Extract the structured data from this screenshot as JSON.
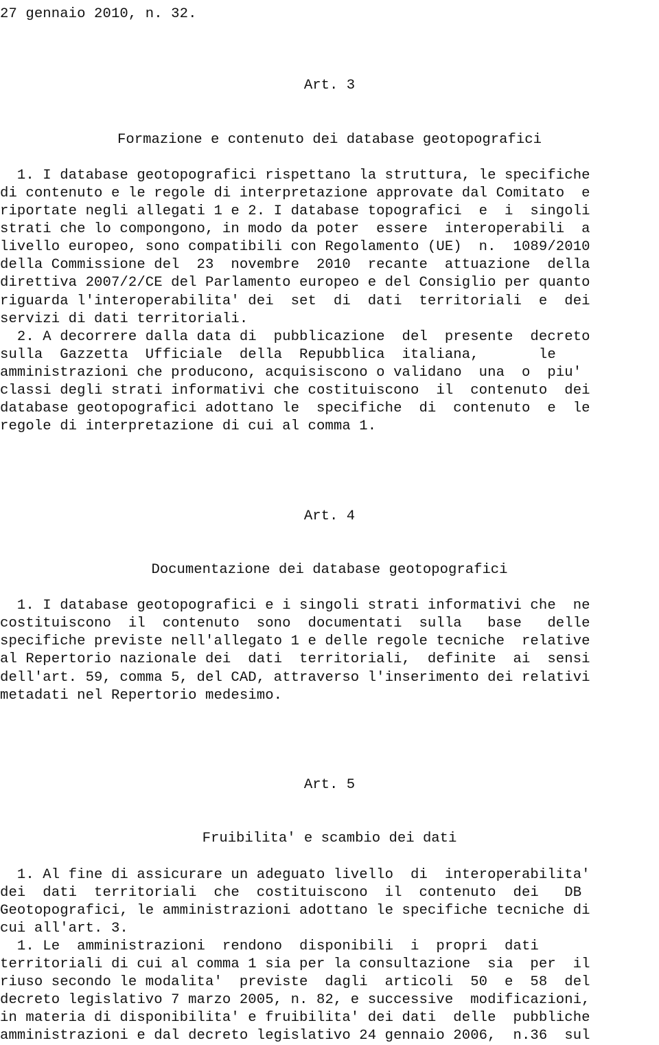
{
  "document": {
    "language": "it",
    "type": "gazzetta-decree-text",
    "continuation_line": "27 gennaio 2010, n. 32.",
    "sections": [
      {
        "id": "art-3",
        "article_number": "Art. 3",
        "article_title": "Formazione e contenuto dei database geotopografici",
        "paragraphs": [
          {
            "number": "1.",
            "lines": [
              "  1. I database geotopografici rispettano la struttura, le specifiche",
              "di contenuto e le regole di interpretazione approvate dal Comitato  e",
              "riportate negli allegati 1 e 2. I database topografici  e  i  singoli",
              "strati che lo compongono, in modo da poter  essere  interoperabili  a",
              "livello europeo, sono compatibili con Regolamento (UE)  n.  1089/2010",
              "della Commissione del  23  novembre  2010  recante  attuazione  della",
              "direttiva 2007/2/CE del Parlamento europeo e del Consiglio per quanto",
              "riguarda l'interoperabilita' dei  set  di  dati  territoriali  e  dei",
              "servizi di dati territoriali."
            ]
          },
          {
            "number": "2.",
            "lines": [
              "  2. A decorrere dalla data di  pubblicazione  del  presente  decreto",
              "sulla  Gazzetta  Ufficiale  della  Repubblica  italiana,       le",
              "amministrazioni che producono, acquisiscono o validano  una  o  piu'",
              "classi degli strati informativi che costituiscono  il  contenuto  dei",
              "database geotopografici adottano le  specifiche  di  contenuto  e  le",
              "regole di interpretazione di cui al comma 1."
            ]
          }
        ]
      },
      {
        "id": "art-4",
        "article_number": "Art. 4",
        "article_title": "Documentazione dei database geotopografici",
        "paragraphs": [
          {
            "number": "1.",
            "lines": [
              "  1. I database geotopografici e i singoli strati informativi che  ne",
              "costituiscono  il  contenuto  sono  documentati  sulla   base   delle",
              "specifiche previste nell'allegato 1 e delle regole tecniche  relative",
              "al Repertorio nazionale dei  dati  territoriali,  definite  ai  sensi",
              "dell'art. 59, comma 5, del CAD, attraverso l'inserimento dei relativi",
              "metadati nel Repertorio medesimo."
            ]
          }
        ]
      },
      {
        "id": "art-5",
        "article_number": "Art. 5",
        "article_title": "Fruibilita' e scambio dei dati",
        "paragraphs": [
          {
            "number": "1.",
            "lines": [
              "  1. Al fine di assicurare un adeguato livello  di  interoperabilita'",
              "dei  dati  territoriali  che  costituiscono  il  contenuto  dei   DB",
              "Geotopografici, le amministrazioni adottano le specifiche tecniche di",
              "cui all'art. 3."
            ]
          },
          {
            "number": "1.",
            "lines": [
              "  1. Le  amministrazioni  rendono  disponibili  i  propri  dati",
              "territoriali di cui al comma 1 sia per la consultazione  sia  per  il",
              "riuso secondo le modalita'  previste  dagli  articoli  50  e  58  del",
              "decreto legislativo 7 marzo 2005, n. 82, e successive  modificazioni,",
              "in materia di disponibilita' e fruibilita' dei dati  delle  pubbliche",
              "amministrazioni e dal decreto legislativo 24 gennaio 2006,  n.36  sul"
            ]
          }
        ]
      }
    ]
  },
  "colors": {
    "page_background": "#ffffff",
    "text": "#111111"
  }
}
